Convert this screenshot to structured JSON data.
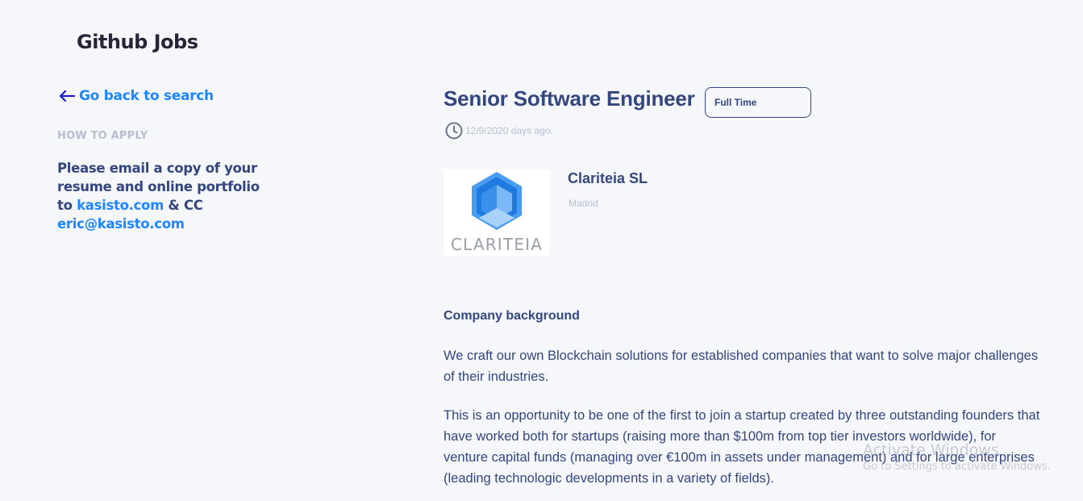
{
  "header": {
    "brand": "Github Jobs"
  },
  "sidebar": {
    "back_label": "Go back to search",
    "how_to_apply_label": "HOW TO APPLY",
    "apply_text_1": "Please email a copy of your resume and online portfolio to ",
    "apply_link_1": "kasisto.com",
    "apply_text_2": " & CC ",
    "apply_link_2": "eric@kasisto.com"
  },
  "job": {
    "title": "Senior Software Engineer",
    "type_badge": "Full Time",
    "posted": "12/9/2020 days ago.",
    "company": "Clariteia SL",
    "location": "Madrid",
    "logo_text": "CLARITEIA",
    "section_heading": "Company background",
    "paragraphs": [
      "We craft our own Blockchain solutions for established companies that want to solve major challenges of their industries.",
      "This is an opportunity to be one of the first to join a startup created by three outstanding founders that have worked both for startups (raising more than $100m from top tier investors worldwide), for venture capital funds (managing over €100m in assets under management) and for large enterprises (leading technologic developments in a variety of fields)."
    ]
  },
  "watermark": {
    "line1": "Activate Windows",
    "line2": "Go to Settings to activate Windows."
  },
  "colors": {
    "accent": "#1e86ff",
    "text": "#334680",
    "muted": "#b9bdcf",
    "background": "#f6f7fb"
  },
  "icons": [
    "arrow-left-icon",
    "clock-icon",
    "clariteia-logo"
  ]
}
